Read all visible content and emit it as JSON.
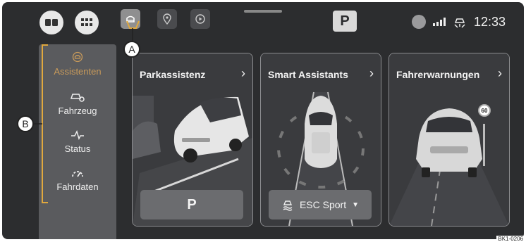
{
  "status": {
    "time": "12:33"
  },
  "topbar": {
    "p_label": "P"
  },
  "sidebar": {
    "items": [
      {
        "label": "Assistenten",
        "icon": "assist-icon",
        "active": true
      },
      {
        "label": "Fahrzeug",
        "icon": "car-gear-icon"
      },
      {
        "label": "Status",
        "icon": "pulse-icon"
      },
      {
        "label": "Fahrdaten",
        "icon": "gauge-icon"
      }
    ]
  },
  "cards": [
    {
      "title": "Parkassistenz",
      "action_label": "P"
    },
    {
      "title": "Smart Assistants",
      "action_label": "ESC Sport"
    },
    {
      "title": "Fahrerwarnungen",
      "sign_value": "60"
    }
  ],
  "callouts": {
    "a": "A",
    "b": "B"
  },
  "image_code": "BK1-0206",
  "colors": {
    "screen_bg": "#2c2d2f",
    "accent": "#c89a5a",
    "sidebar_bg": "#5a5b5e",
    "callout_line": "#e0a83e"
  }
}
